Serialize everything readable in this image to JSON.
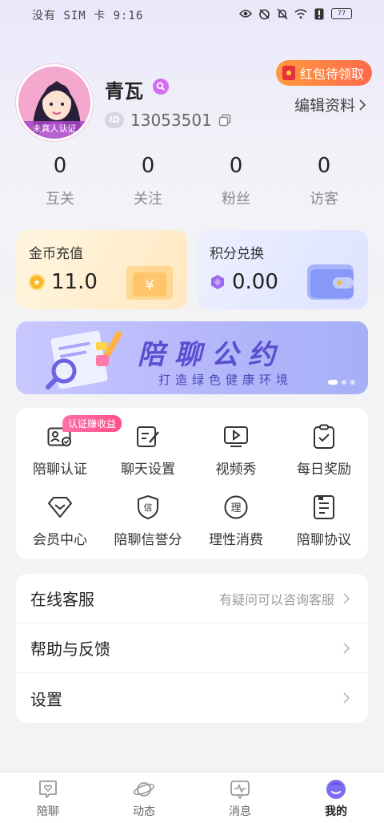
{
  "status_bar": {
    "left_text": "没有 SIM 卡 9:16",
    "battery": "77"
  },
  "profile": {
    "avatar_badge": "未真人认证",
    "nickname": "青瓦",
    "id_label": "ID",
    "id_number": "13053501",
    "redpacket_label": "红包待领取",
    "edit_label": "编辑资料"
  },
  "stats": [
    {
      "value": "0",
      "label": "互关"
    },
    {
      "value": "0",
      "label": "关注"
    },
    {
      "value": "0",
      "label": "粉丝"
    },
    {
      "value": "0",
      "label": "访客"
    }
  ],
  "wallet": {
    "coin": {
      "title": "金币充值",
      "value": "11.0"
    },
    "points": {
      "title": "积分兑换",
      "value": "0.00"
    }
  },
  "banner": {
    "title": "陪聊公约",
    "subtitle": "打造绿色健康环境"
  },
  "functions": {
    "badge": "认证赚收益",
    "items": [
      {
        "label": "陪聊认证",
        "icon": "id-card-icon"
      },
      {
        "label": "聊天设置",
        "icon": "edit-icon"
      },
      {
        "label": "视频秀",
        "icon": "video-icon"
      },
      {
        "label": "每日奖励",
        "icon": "clipboard-check-icon"
      },
      {
        "label": "会员中心",
        "icon": "diamond-icon"
      },
      {
        "label": "陪聊信誉分",
        "icon": "shield-credit-icon"
      },
      {
        "label": "理性消费",
        "icon": "reason-icon"
      },
      {
        "label": "陪聊协议",
        "icon": "document-icon"
      }
    ],
    "credit_char": "信",
    "reason_char": "理"
  },
  "menu": [
    {
      "label": "在线客服",
      "hint": "有疑问可以咨询客服"
    },
    {
      "label": "帮助与反馈",
      "hint": ""
    },
    {
      "label": "设置",
      "hint": ""
    }
  ],
  "tabs": [
    {
      "label": "陪聊",
      "icon": "heart-chat-icon"
    },
    {
      "label": "动态",
      "icon": "planet-icon"
    },
    {
      "label": "消息",
      "icon": "message-icon"
    },
    {
      "label": "我的",
      "icon": "profile-face-icon",
      "active": true
    }
  ],
  "colors": {
    "accent": "#7c6cf0",
    "redpacket": "#ff7a45",
    "badge_pink": "#ff5a90"
  }
}
